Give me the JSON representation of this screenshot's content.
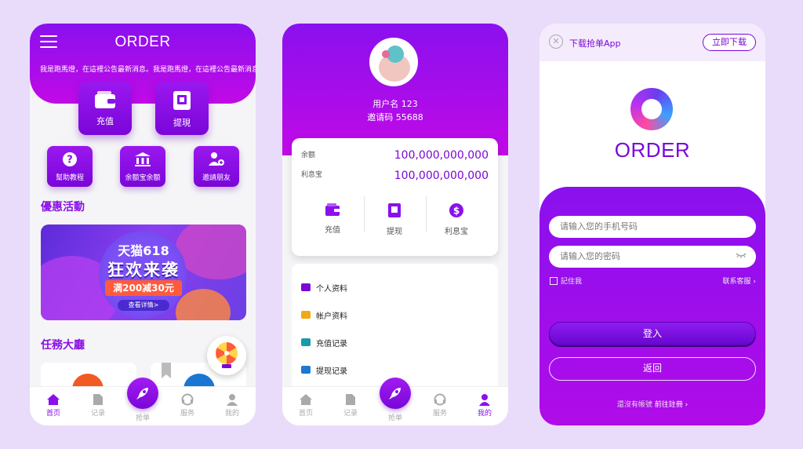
{
  "screen1": {
    "title": "ORDER",
    "marquee": "我是跑馬燈，在這裡公告最新消息。我是跑馬燈，在這裡公告最新消息",
    "recharge": "充值",
    "withdraw": "提現",
    "help": "幫助教程",
    "balance_treasure": "余额宝余额",
    "invite": "邀請朋友",
    "promo_title": "優惠活動",
    "banner": {
      "line1": "天猫618",
      "line2": "狂欢来袭",
      "line3": "满200减30元",
      "line4": "查看详情>"
    },
    "task_title": "任務大廳",
    "nav": [
      "首页",
      "记录",
      "抢单",
      "服务",
      "我的"
    ]
  },
  "screen2": {
    "username": "用户名  123",
    "invite_code": "邀请码  55688",
    "balance_label": "余额",
    "balance_value": "100,000,000,000",
    "interest_label": "利息宝",
    "interest_value": "100,000,000,000",
    "actions": [
      "充值",
      "提现",
      "利息宝"
    ],
    "menu": [
      "个人资料",
      "帐户资料",
      "充值记录",
      "提现记录"
    ],
    "nav": [
      "首页",
      "记录",
      "抢单",
      "服务",
      "我的"
    ]
  },
  "screen3": {
    "download_text": "下载抢单App",
    "download_button": "立即下载",
    "brand": "ORDER",
    "phone_placeholder": "请输入您的手机号码",
    "password_placeholder": "请输入您的密码",
    "remember": "記住我",
    "support": "联系客服 ›",
    "login": "登入",
    "back": "返回",
    "register_prefix": "還沒有帳號",
    "register_link": "前往註冊 ›"
  },
  "colors": {
    "accent": "#8a10ee",
    "accent_dark": "#7a06d8",
    "magenta": "#c10ae6"
  }
}
